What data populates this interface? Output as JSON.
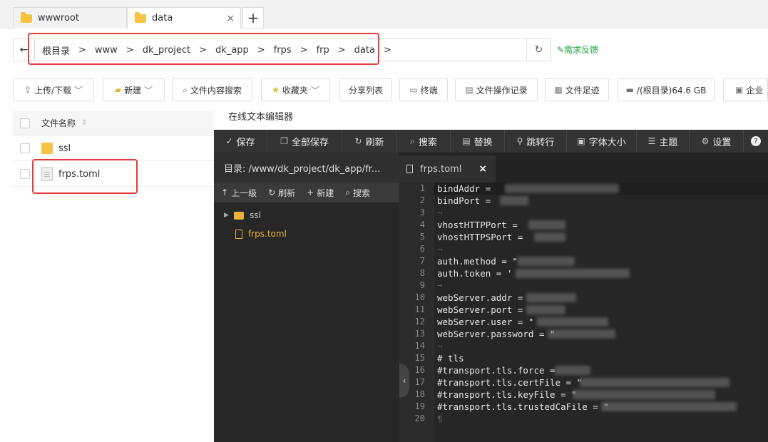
{
  "tabs": [
    {
      "label": "wwwroot"
    },
    {
      "label": "data",
      "close": "×"
    }
  ],
  "tab_add": "+",
  "breadcrumbs": [
    "根目录",
    "www",
    "dk_project",
    "dk_app",
    "frps",
    "frp",
    "data"
  ],
  "breadcrumb_sep": ">",
  "feedback": "需求反馈",
  "toolbar": {
    "upload": "上传/下载",
    "new": "新建",
    "search": "文件内容搜索",
    "favorites": "收藏夹",
    "share": "分享列表",
    "terminal": "终端",
    "oplog": "文件操作记录",
    "footprint": "文件足迹",
    "disk": "/(根目录)64.6 GB",
    "enterprise": "企业"
  },
  "filelist": {
    "header": "文件名称",
    "rows": [
      {
        "name": "ssl",
        "type": "folder"
      },
      {
        "name": "frps.toml",
        "type": "file"
      }
    ]
  },
  "editor": {
    "title": "在线文本编辑器",
    "buttons": [
      "保存",
      "全部保存",
      "刷新",
      "搜索",
      "替换",
      "跳转行",
      "字体大小",
      "主题",
      "设置"
    ],
    "dir_label": "目录: /www/dk_project/dk_app/fr...",
    "ops": [
      "上一级",
      "刷新",
      "新建",
      "搜索"
    ],
    "tree": [
      {
        "name": "ssl",
        "type": "folder"
      },
      {
        "name": "frps.toml",
        "type": "file"
      }
    ],
    "active_tab": "frps.toml",
    "tab_close": "×",
    "lines": [
      "bindAddr = ",
      "bindPort = ",
      "¬",
      "vhostHTTPPort = ",
      "vhostHTTPSPort = ",
      "¬",
      "auth.method = \"",
      "auth.token = '",
      "¬",
      "webServer.addr = ",
      "webServer.port = ",
      "webServer.user = \"",
      "webServer.password = \"",
      "¬",
      "# tls",
      "#transport.tls.force = ",
      "#transport.tls.certFile = \"",
      "#transport.tls.keyFile = \"",
      "#transport.tls.trustedCaFile = \"",
      "¶"
    ]
  },
  "colors": {
    "accent_green": "#20a53a",
    "highlight_red": "#e83a3a",
    "editor_bg": "#2b2b2b",
    "folder_yellow": "#f6c343"
  }
}
